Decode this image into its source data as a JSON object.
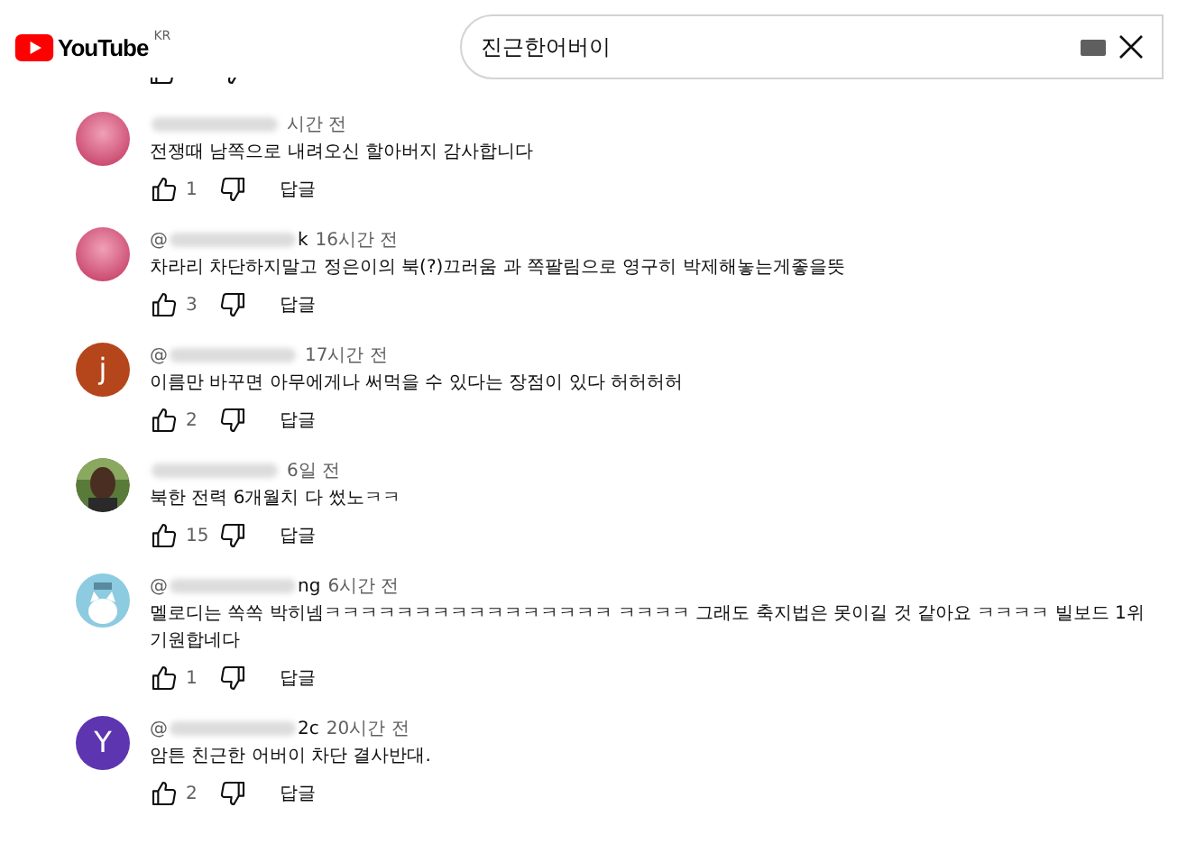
{
  "header": {
    "logo_text": "YouTube",
    "region": "KR",
    "search": {
      "value": "진근한어버이"
    }
  },
  "comments": [
    {
      "avatar": {
        "kind": "pink"
      },
      "time": "시간 전",
      "text": "전쟁때 남쪽으로 내려오신 할아버지 감사합니다",
      "likes": "1",
      "reply": "답글"
    },
    {
      "avatar": {
        "kind": "pink"
      },
      "author_prefix": "@",
      "author_suffix": "k",
      "time": "16시간 전",
      "text": "차라리 차단하지말고 정은이의 북(?)끄러움 과 쪽팔림으로 영구히 박제해놓는게좋을뜻",
      "likes": "3",
      "reply": "답글"
    },
    {
      "avatar": {
        "kind": "letter",
        "letter": "j",
        "color": "#b5461c"
      },
      "author_prefix": "@",
      "time": "17시간 전",
      "text": "이름만 바꾸면 아무에게나 써먹을 수 있다는 장점이 있다 허허허허",
      "likes": "2",
      "reply": "답글"
    },
    {
      "time": "6일 전",
      "text": "북한 전력 6개월치 다 썼노ㅋㅋ",
      "likes": "15",
      "reply": "답글"
    },
    {
      "avatar": {
        "kind": "cat"
      },
      "author_prefix": "@",
      "author_suffix": "ng",
      "time": "6시간 전",
      "text": "멜로디는 쏙쏙 박히넴ㅋㅋㅋㅋㅋㅋㅋㅋㅋㅋㅋㅋㅋㅋㅋㅋ ㅋㅋㅋㅋ 그래도 축지법은 못이길 것 같아요 ㅋㅋㅋㅋ 빌보드 1위 기원합네다",
      "likes": "1",
      "reply": "답글"
    },
    {
      "avatar": {
        "kind": "letter",
        "letter": "Y",
        "color": "#5e35b1"
      },
      "author_prefix": "@",
      "author_suffix": "2c",
      "time": "20시간 전",
      "text": "암튼 친근한 어버이 차단 결사반대.",
      "likes": "2",
      "reply": "답글"
    }
  ]
}
